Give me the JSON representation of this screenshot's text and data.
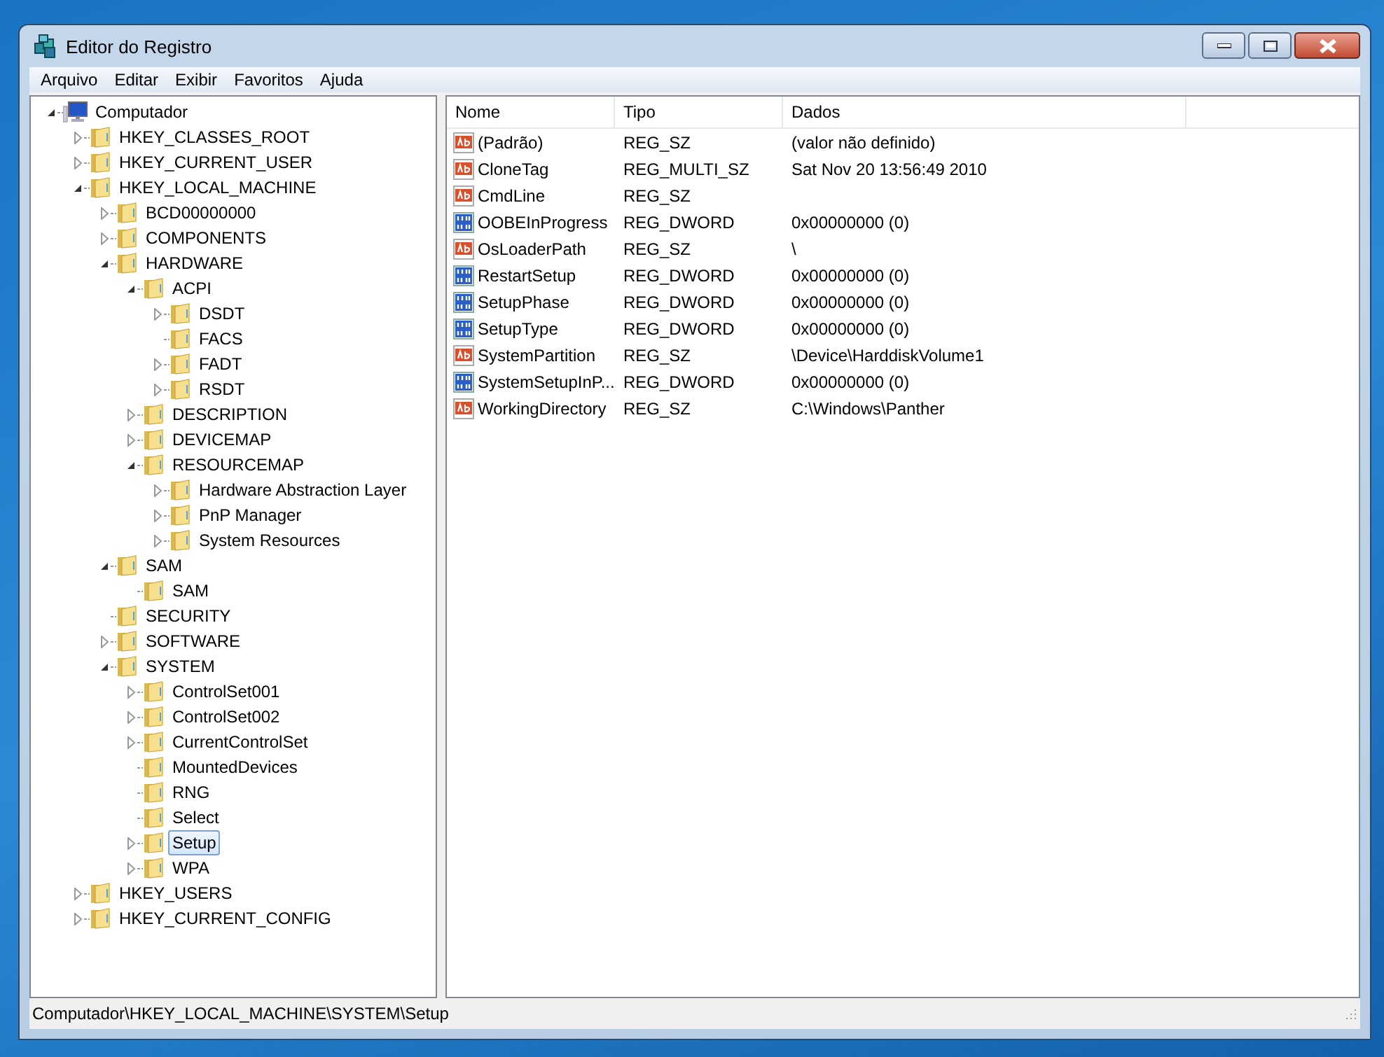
{
  "window": {
    "title": "Editor do Registro"
  },
  "menu": [
    "Arquivo",
    "Editar",
    "Exibir",
    "Favoritos",
    "Ajuda"
  ],
  "tree": {
    "label": "Computador",
    "kind": "computer",
    "expanded": true,
    "selected": false,
    "children": [
      {
        "label": "HKEY_CLASSES_ROOT",
        "kind": "branch",
        "expanded": false,
        "selected": false
      },
      {
        "label": "HKEY_CURRENT_USER",
        "kind": "branch",
        "expanded": false,
        "selected": false
      },
      {
        "label": "HKEY_LOCAL_MACHINE",
        "kind": "branch",
        "expanded": true,
        "selected": false,
        "children": [
          {
            "label": "BCD00000000",
            "kind": "branch",
            "expanded": false,
            "selected": false
          },
          {
            "label": "COMPONENTS",
            "kind": "branch",
            "expanded": false,
            "selected": false
          },
          {
            "label": "HARDWARE",
            "kind": "branch",
            "expanded": true,
            "selected": false,
            "children": [
              {
                "label": "ACPI",
                "kind": "branch",
                "expanded": true,
                "selected": false,
                "children": [
                  {
                    "label": "DSDT",
                    "kind": "branch",
                    "expanded": false,
                    "selected": false
                  },
                  {
                    "label": "FACS",
                    "kind": "leaf",
                    "selected": false
                  },
                  {
                    "label": "FADT",
                    "kind": "branch",
                    "expanded": false,
                    "selected": false
                  },
                  {
                    "label": "RSDT",
                    "kind": "branch",
                    "expanded": false,
                    "selected": false
                  }
                ]
              },
              {
                "label": "DESCRIPTION",
                "kind": "branch",
                "expanded": false,
                "selected": false
              },
              {
                "label": "DEVICEMAP",
                "kind": "branch",
                "expanded": false,
                "selected": false
              },
              {
                "label": "RESOURCEMAP",
                "kind": "branch",
                "expanded": true,
                "selected": false,
                "children": [
                  {
                    "label": "Hardware Abstraction Layer",
                    "kind": "branch",
                    "expanded": false,
                    "selected": false
                  },
                  {
                    "label": "PnP Manager",
                    "kind": "branch",
                    "expanded": false,
                    "selected": false
                  },
                  {
                    "label": "System Resources",
                    "kind": "branch",
                    "expanded": false,
                    "selected": false
                  }
                ]
              }
            ]
          },
          {
            "label": "SAM",
            "kind": "branch",
            "expanded": true,
            "selected": false,
            "children": [
              {
                "label": "SAM",
                "kind": "leaf",
                "selected": false
              }
            ]
          },
          {
            "label": "SECURITY",
            "kind": "leaf",
            "selected": false
          },
          {
            "label": "SOFTWARE",
            "kind": "branch",
            "expanded": false,
            "selected": false
          },
          {
            "label": "SYSTEM",
            "kind": "branch",
            "expanded": true,
            "selected": false,
            "children": [
              {
                "label": "ControlSet001",
                "kind": "branch",
                "expanded": false,
                "selected": false
              },
              {
                "label": "ControlSet002",
                "kind": "branch",
                "expanded": false,
                "selected": false
              },
              {
                "label": "CurrentControlSet",
                "kind": "branch",
                "expanded": false,
                "selected": false
              },
              {
                "label": "MountedDevices",
                "kind": "leaf",
                "selected": false
              },
              {
                "label": "RNG",
                "kind": "leaf",
                "selected": false
              },
              {
                "label": "Select",
                "kind": "leaf",
                "selected": false
              },
              {
                "label": "Setup",
                "kind": "branch",
                "expanded": false,
                "selected": true
              },
              {
                "label": "WPA",
                "kind": "branch",
                "expanded": false,
                "selected": false
              }
            ]
          }
        ]
      },
      {
        "label": "HKEY_USERS",
        "kind": "branch",
        "expanded": false,
        "selected": false
      },
      {
        "label": "HKEY_CURRENT_CONFIG",
        "kind": "branch",
        "expanded": false,
        "selected": false
      }
    ]
  },
  "table": {
    "columns": [
      "Nome",
      "Tipo",
      "Dados"
    ],
    "rows": [
      {
        "kind": "string",
        "name": "(Padrão)",
        "type": "REG_SZ",
        "data": "(valor não definido)"
      },
      {
        "kind": "string",
        "name": "CloneTag",
        "type": "REG_MULTI_SZ",
        "data": "Sat Nov 20 13:56:49 2010"
      },
      {
        "kind": "string",
        "name": "CmdLine",
        "type": "REG_SZ"
      },
      {
        "kind": "binary",
        "name": "OOBEInProgress",
        "type": "REG_DWORD",
        "data": "0x00000000 (0)"
      },
      {
        "kind": "string",
        "name": "OsLoaderPath",
        "type": "REG_SZ",
        "data": "\\"
      },
      {
        "kind": "binary",
        "name": "RestartSetup",
        "type": "REG_DWORD",
        "data": "0x00000000 (0)"
      },
      {
        "kind": "binary",
        "name": "SetupPhase",
        "type": "REG_DWORD",
        "data": "0x00000000 (0)"
      },
      {
        "kind": "binary",
        "name": "SetupType",
        "type": "REG_DWORD",
        "data": "0x00000000 (0)"
      },
      {
        "kind": "string",
        "name": "SystemPartition",
        "type": "REG_SZ",
        "data": "\\Device\\HarddiskVolume1"
      },
      {
        "kind": "binary",
        "name": "SystemSetupInP...",
        "type": "REG_DWORD",
        "data": "0x00000000 (0)"
      },
      {
        "kind": "string",
        "name": "WorkingDirectory",
        "type": "REG_SZ",
        "data": "C:\\Windows\\Panther"
      }
    ]
  },
  "status_bar": "Computador\\HKEY_LOCAL_MACHINE\\SYSTEM\\Setup"
}
